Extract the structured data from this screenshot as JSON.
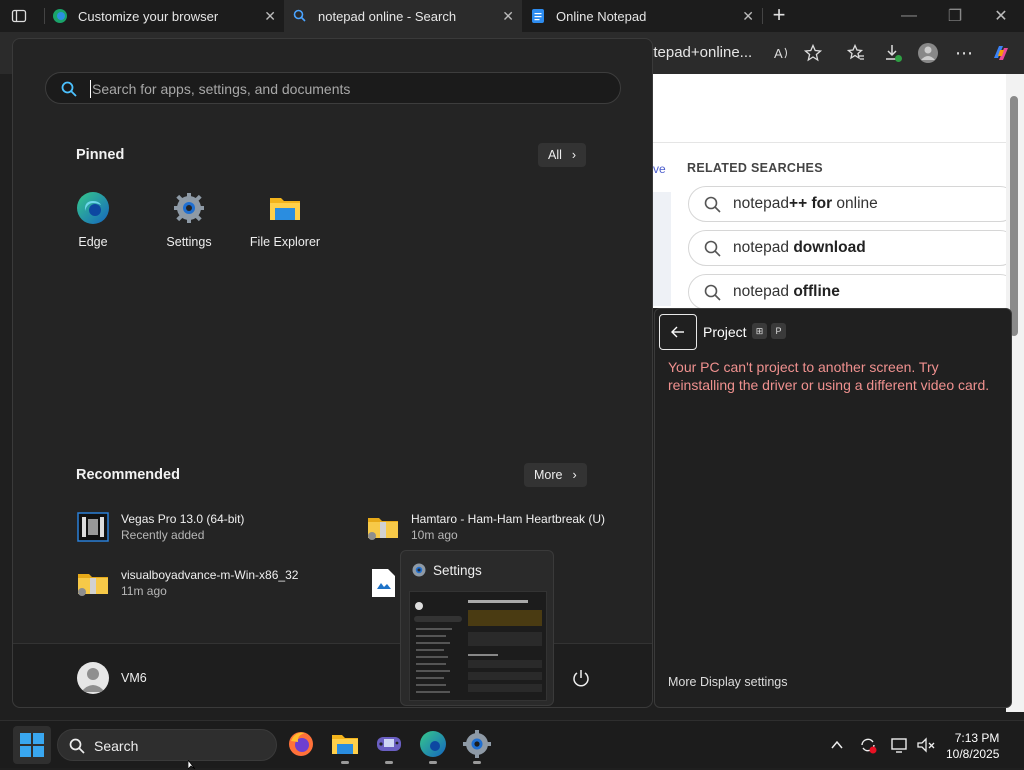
{
  "browser": {
    "tabs": [
      {
        "title": "Customize your browser",
        "active": false
      },
      {
        "title": "notepad online - Search",
        "active": true
      },
      {
        "title": "Online Notepad",
        "active": false
      }
    ],
    "address_fragment": "otepad+online...",
    "new_tab_symbol": "+",
    "close_symbol": "✕"
  },
  "webpage": {
    "related_searches_title": "RELATED SEARCHES",
    "fragment_left": "ve",
    "related": [
      {
        "prefix": "notepad",
        "bold": "++ for",
        "suffix": " online"
      },
      {
        "prefix": "notepad ",
        "bold": "download",
        "suffix": ""
      },
      {
        "prefix": "notepad ",
        "bold": "offline",
        "suffix": ""
      }
    ]
  },
  "start_menu": {
    "search_placeholder": "Search for apps, settings, and documents",
    "pinned_title": "Pinned",
    "all_button": "All",
    "pinned_apps": [
      {
        "label": "Edge",
        "icon": "edge-icon"
      },
      {
        "label": "Settings",
        "icon": "settings-gear-icon"
      },
      {
        "label": "File Explorer",
        "icon": "folder-icon"
      }
    ],
    "recommended_title": "Recommended",
    "more_button": "More",
    "recommended": [
      {
        "name": "Vegas Pro 13.0 (64-bit)",
        "sub": "Recently added",
        "icon": "film-icon"
      },
      {
        "name": "Hamtaro - Ham-Ham Heartbreak (U)",
        "sub": "10m ago",
        "icon": "zip-folder-icon"
      },
      {
        "name": "visualboyadvance-m-Win-x86_32",
        "sub": "11m ago",
        "icon": "zip-folder-icon"
      },
      {
        "name": "",
        "sub": "",
        "icon": "image-file-icon"
      }
    ],
    "user_name": "VM6"
  },
  "settings_thumbnail": {
    "title": "Settings"
  },
  "project_panel": {
    "title": "Project",
    "key1": "⊞",
    "key2": "P",
    "error": "Your PC can't project to another screen. Try reinstalling the driver or using a different video card.",
    "more_link": "More Display settings"
  },
  "taskbar": {
    "search_label": "Search",
    "time": "7:13 PM",
    "date": "10/8/2025"
  },
  "colors": {
    "accent": "#0078d4",
    "error_text": "#f0918f",
    "panel_bg": "#242424"
  }
}
